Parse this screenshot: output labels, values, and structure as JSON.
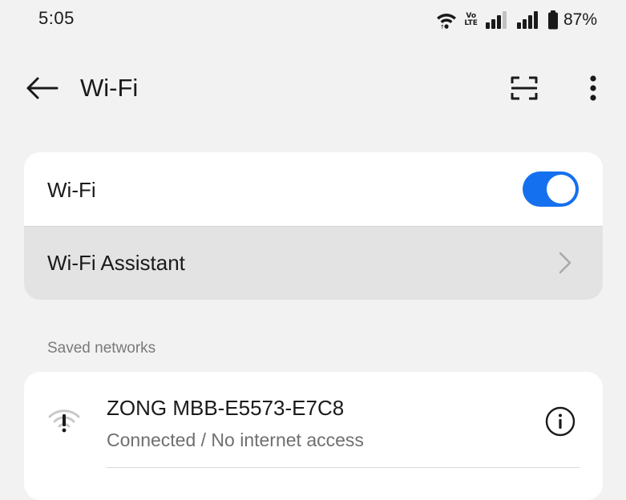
{
  "status_bar": {
    "time": "5:05",
    "volte_top": "Vo",
    "volte_bottom": "LTE",
    "battery_percent": "87%",
    "battery_level": 0.87,
    "icons": [
      "wifi-icon",
      "volte-icon",
      "signal-icon",
      "signal-icon",
      "battery-icon"
    ]
  },
  "header": {
    "title": "Wi-Fi",
    "icons": [
      "back-arrow-icon",
      "scan-icon",
      "more-vert-icon"
    ]
  },
  "wifi_card": {
    "wifi_label": "Wi-Fi",
    "wifi_enabled": true,
    "assistant_label": "Wi-Fi Assistant"
  },
  "saved_networks": {
    "section_label": "Saved networks",
    "items": [
      {
        "name": "ZONG MBB-E5573-E7C8",
        "status": "Connected / No internet access",
        "icon": "wifi-no-internet-icon"
      }
    ]
  },
  "colors": {
    "accent": "#1570ef",
    "background": "#f2f2f2",
    "card": "#ffffff",
    "pressed_row": "#e3e3e3",
    "secondary_text": "#6f6f6f"
  }
}
